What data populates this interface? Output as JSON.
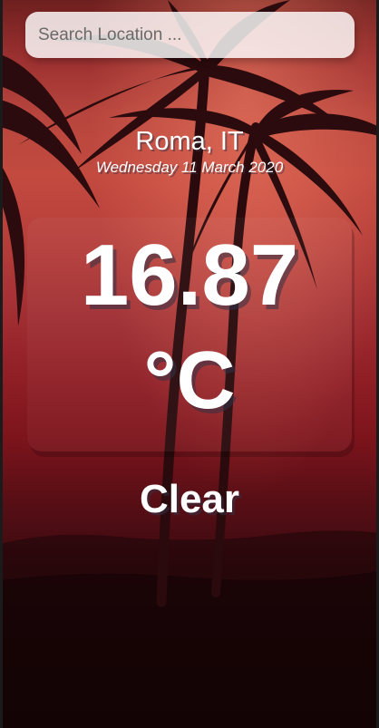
{
  "search": {
    "placeholder": "Search Location ...",
    "value": ""
  },
  "location": {
    "city": "Roma, IT",
    "date": "Wednesday 11 March 2020"
  },
  "temperature": {
    "value": "16.87",
    "unit": "°C"
  },
  "weather": {
    "condition": "Clear"
  },
  "theme": {
    "sky_top": "#9c3030",
    "sky_mid": "#c24a3f",
    "sky_low": "#7d141c",
    "ground": "#150405",
    "text": "#ffffff"
  }
}
